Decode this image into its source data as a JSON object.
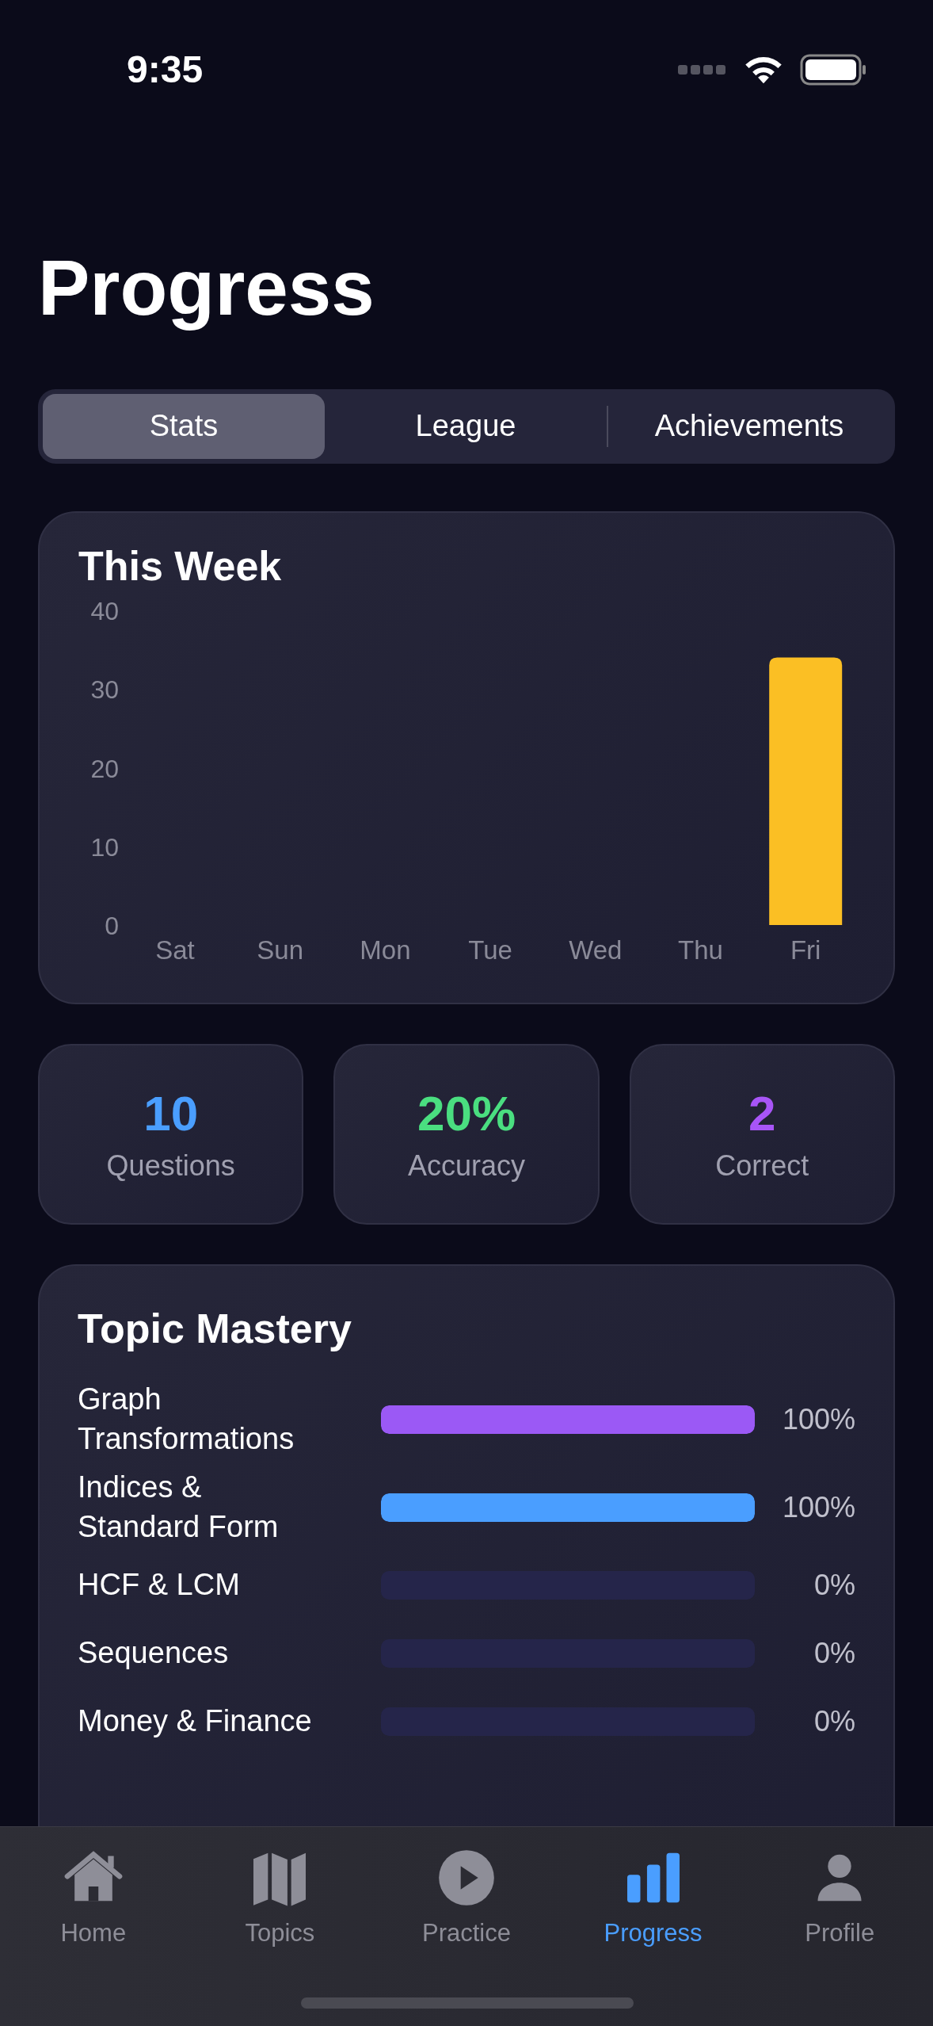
{
  "status_bar": {
    "time": "9:35"
  },
  "title": "Progress",
  "segments": [
    {
      "label": "Stats",
      "selected": true
    },
    {
      "label": "League",
      "selected": false
    },
    {
      "label": "Achievements",
      "selected": false
    }
  ],
  "week_card": {
    "title": "This Week",
    "chart_data": {
      "type": "bar",
      "categories": [
        "Sat",
        "Sun",
        "Mon",
        "Tue",
        "Wed",
        "Thu",
        "Fri"
      ],
      "series": [
        {
          "color": "#fbbf24",
          "values": [
            0,
            0,
            0,
            0,
            0,
            0,
            34
          ]
        }
      ],
      "ylim": [
        0,
        40
      ],
      "yticks": [
        0,
        10,
        20,
        30,
        40
      ]
    }
  },
  "stats": [
    {
      "value": "10",
      "label": "Questions",
      "color": "#4a9eff"
    },
    {
      "value": "20%",
      "label": "Accuracy",
      "color": "#4ade80"
    },
    {
      "value": "2",
      "label": "Correct",
      "color": "#a855f7"
    }
  ],
  "mastery": {
    "title": "Topic Mastery",
    "topics": [
      {
        "name": "Graph Transformations",
        "level": 1,
        "percent": "100%",
        "color": "#9b59f5"
      },
      {
        "name": "Indices & Standard Form",
        "level": 1,
        "percent": "100%",
        "color": "#4a9eff"
      },
      {
        "name": "HCF & LCM",
        "level": 0,
        "percent": "0%"
      },
      {
        "name": "Sequences",
        "level": 0,
        "percent": "0%"
      },
      {
        "name": "Money & Finance",
        "level": 0,
        "percent": "0%"
      }
    ]
  },
  "tab_bar": [
    {
      "label": "Home",
      "kind": "home",
      "selected": false
    },
    {
      "label": "Topics",
      "kind": "map",
      "selected": false
    },
    {
      "label": "Practice",
      "kind": "play",
      "selected": false
    },
    {
      "label": "Progress",
      "kind": "bars",
      "selected": true
    },
    {
      "label": "Profile",
      "kind": "person",
      "selected": false
    }
  ]
}
